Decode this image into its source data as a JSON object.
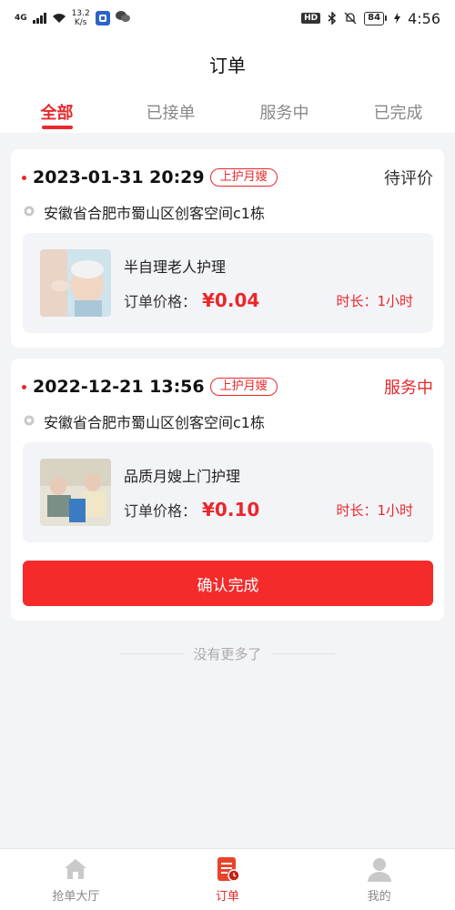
{
  "status_bar": {
    "network": "4G",
    "speed_value": "13.2",
    "speed_unit": "K/s",
    "hd": "HD",
    "battery": "84",
    "time": "4:56"
  },
  "header": {
    "title": "订单"
  },
  "tabs": [
    {
      "label": "全部",
      "active": true
    },
    {
      "label": "已接单",
      "active": false
    },
    {
      "label": "服务中",
      "active": false
    },
    {
      "label": "已完成",
      "active": false
    }
  ],
  "orders": [
    {
      "datetime": "2023-01-31 20:29",
      "tag": "上护月嫂",
      "status": "待评价",
      "address": "安徽省合肥市蜀山区创客空间c1栋",
      "service_name": "半自理老人护理",
      "price_label": "订单价格：",
      "price": "¥0.04",
      "duration": "时长：1小时"
    },
    {
      "datetime": "2022-12-21 13:56",
      "tag": "上护月嫂",
      "status": "服务中",
      "address": "安徽省合肥市蜀山区创客空间c1栋",
      "service_name": "品质月嫂上门护理",
      "price_label": "订单价格：",
      "price": "¥0.10",
      "duration": "时长：1小时",
      "action_label": "确认完成"
    }
  ],
  "footer_text": "没有更多了",
  "bottom_nav": [
    {
      "label": "抢单大厅",
      "icon": "home-icon",
      "active": false
    },
    {
      "label": "订单",
      "icon": "order-icon",
      "active": true
    },
    {
      "label": "我的",
      "icon": "user-icon",
      "active": false
    }
  ],
  "colors": {
    "accent": "#e8282b",
    "button": "#f52a2a",
    "background": "#f3f4f6"
  }
}
